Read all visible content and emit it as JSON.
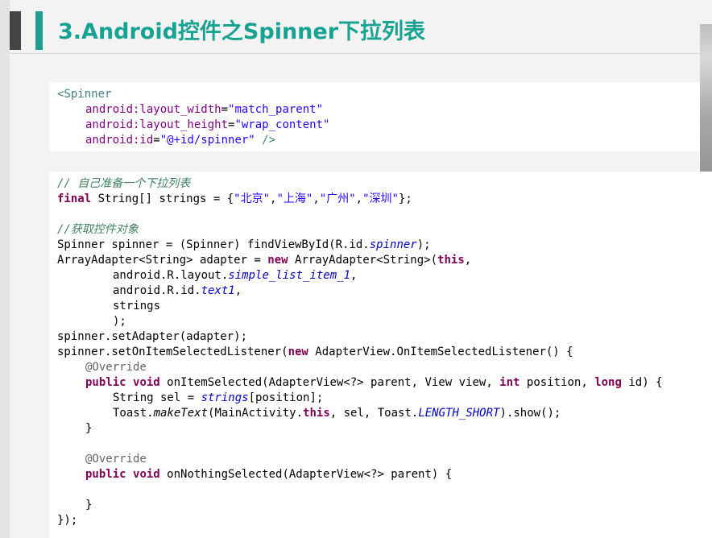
{
  "slide": {
    "title": "3.Android控件之Spinner下拉列表"
  },
  "xml_code": {
    "line1": "<Spinner",
    "line2_attr": "android:layout_width",
    "line2_eq": "=",
    "line2_val": "\"match_parent\"",
    "line3_attr": "android:layout_height",
    "line3_eq": "=",
    "line3_val": "\"wrap_content\"",
    "line4_attr": "android:id",
    "line4_eq": "=",
    "line4_val": "\"@+id/spinner\"",
    "line4_end": " />"
  },
  "java_code": {
    "c1": "// 自己准备一个下拉列表",
    "l2_kw": "final",
    "l2_a": " String[] strings = {",
    "l2_s1": "\"北京\"",
    "l2_s2": "\"上海\"",
    "l2_s3": "\"广州\"",
    "l2_s4": "\"深圳\"",
    "l2_end": "};",
    "c3": "//获取控件对象",
    "l4": "Spinner spinner = (Spinner) findViewById(R.id.",
    "l4_f": "spinner",
    "l4_end": ");",
    "l5_a": "ArrayAdapter<String> adapter = ",
    "l5_kw": "new",
    "l5_b": " ArrayAdapter<String>(",
    "l5_kw2": "this",
    "l5_end": ",",
    "l6_a": "android.R.layout.",
    "l6_f": "simple_list_item_1",
    "l6_end": ",",
    "l7_a": "android.R.id.",
    "l7_f": "text1",
    "l7_end": ",",
    "l8": "strings",
    "l9": ");",
    "l10": "spinner.setAdapter(adapter);",
    "l11_a": "spinner.setOnItemSelectedListener(",
    "l11_kw": "new",
    "l11_b": " AdapterView.OnItemSelectedListener() {",
    "l12_ann": "@Override",
    "l13_kw": "public",
    "l13_kw2": "void",
    "l13_a": " onItemSelected(AdapterView<?> parent, View view, ",
    "l13_kw3": "int",
    "l13_b": " position, ",
    "l13_kw4": "long",
    "l13_c": " id) {",
    "l14_a": "String sel = ",
    "l14_f": "strings",
    "l14_b": "[position];",
    "l15_a": "Toast.",
    "l15_m": "makeText",
    "l15_b": "(MainActivity.",
    "l15_kw": "this",
    "l15_c": ", sel, Toast.",
    "l15_f": "LENGTH_SHORT",
    "l15_d": ").show();",
    "l16": "}",
    "l17_ann": "@Override",
    "l18_kw": "public",
    "l18_kw2": "void",
    "l18_a": " onNothingSelected(AdapterView<?> parent) {",
    "l19": "}",
    "l20": "});"
  }
}
